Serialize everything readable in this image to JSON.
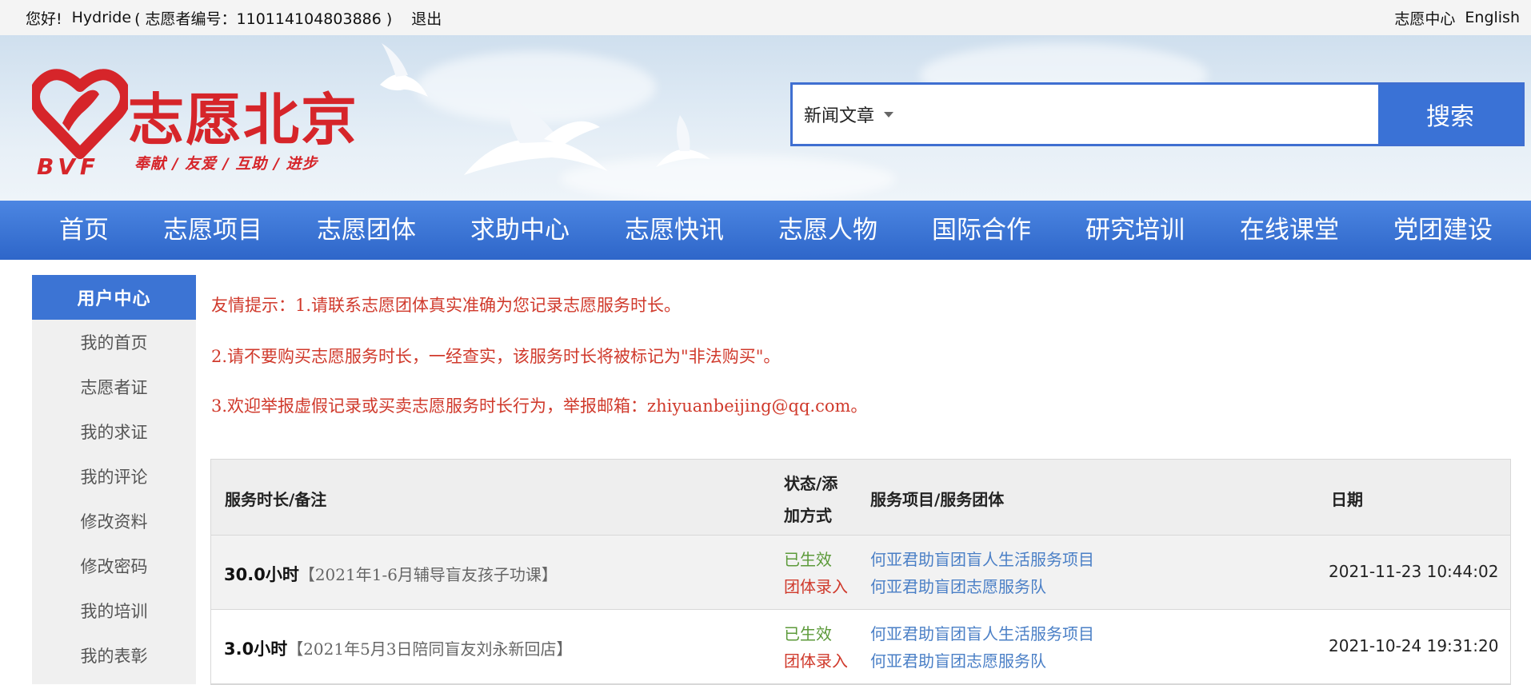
{
  "topbar": {
    "greeting": "您好!",
    "username": "Hydride",
    "volunteer_id_text": "( 志愿者编号：110114104803886 )",
    "logout": "退出",
    "volunteer_center": "志愿中心",
    "english": "English"
  },
  "header": {
    "logo_text": "志愿北京",
    "logo_abbr": "BVF",
    "slogan": "奉献 / 友爱 / 互助 / 进步",
    "search": {
      "category": "新闻文章",
      "placeholder": "",
      "button": "搜索"
    }
  },
  "nav": {
    "items": [
      "首页",
      "志愿项目",
      "志愿团体",
      "求助中心",
      "志愿快讯",
      "志愿人物",
      "国际合作",
      "研究培训",
      "在线课堂",
      "党团建设"
    ]
  },
  "sidebar": {
    "title": "用户中心",
    "items": [
      "我的首页",
      "志愿者证",
      "我的求证",
      "我的评论",
      "修改资料",
      "修改密码",
      "我的培训",
      "我的表彰"
    ]
  },
  "notice": {
    "line1": "友情提示：1.请联系志愿团体真实准确为您记录志愿服务时长。",
    "line2": "2.请不要购买志愿服务时长，一经查实，该服务时长将被标记为\"非法购买\"。",
    "line3": "3.欢迎举报虚假记录或买卖志愿服务时长行为，举报邮箱：zhiyuanbeijing@qq.com。"
  },
  "table": {
    "headers": {
      "hours_remark": "服务时长/备注",
      "status_line1": "状态/添",
      "status_line2": "加方式",
      "project_group": "服务项目/服务团体",
      "date": "日期"
    },
    "rows": [
      {
        "hours": "30.0小时",
        "remark": "【2021年1-6月辅导盲友孩子功课】",
        "status": "已生效",
        "method": "团体录入",
        "project": "何亚君助盲团盲人生活服务项目",
        "group": "何亚君助盲团志愿服务队",
        "date": "2021-11-23 10:44:02"
      },
      {
        "hours": "3.0小时",
        "remark": "【2021年5月3日陪同盲友刘永新回店】",
        "status": "已生效",
        "method": "团体录入",
        "project": "何亚君助盲团盲人生活服务项目",
        "group": "何亚君助盲团志愿服务队",
        "date": "2021-10-24 19:31:20"
      }
    ]
  },
  "colors": {
    "brand_red": "#d6252a",
    "nav_blue": "#3a72d6",
    "notice_red": "#d03a2c",
    "status_green": "#5c9a3a",
    "link_blue": "#4a7fc6"
  }
}
